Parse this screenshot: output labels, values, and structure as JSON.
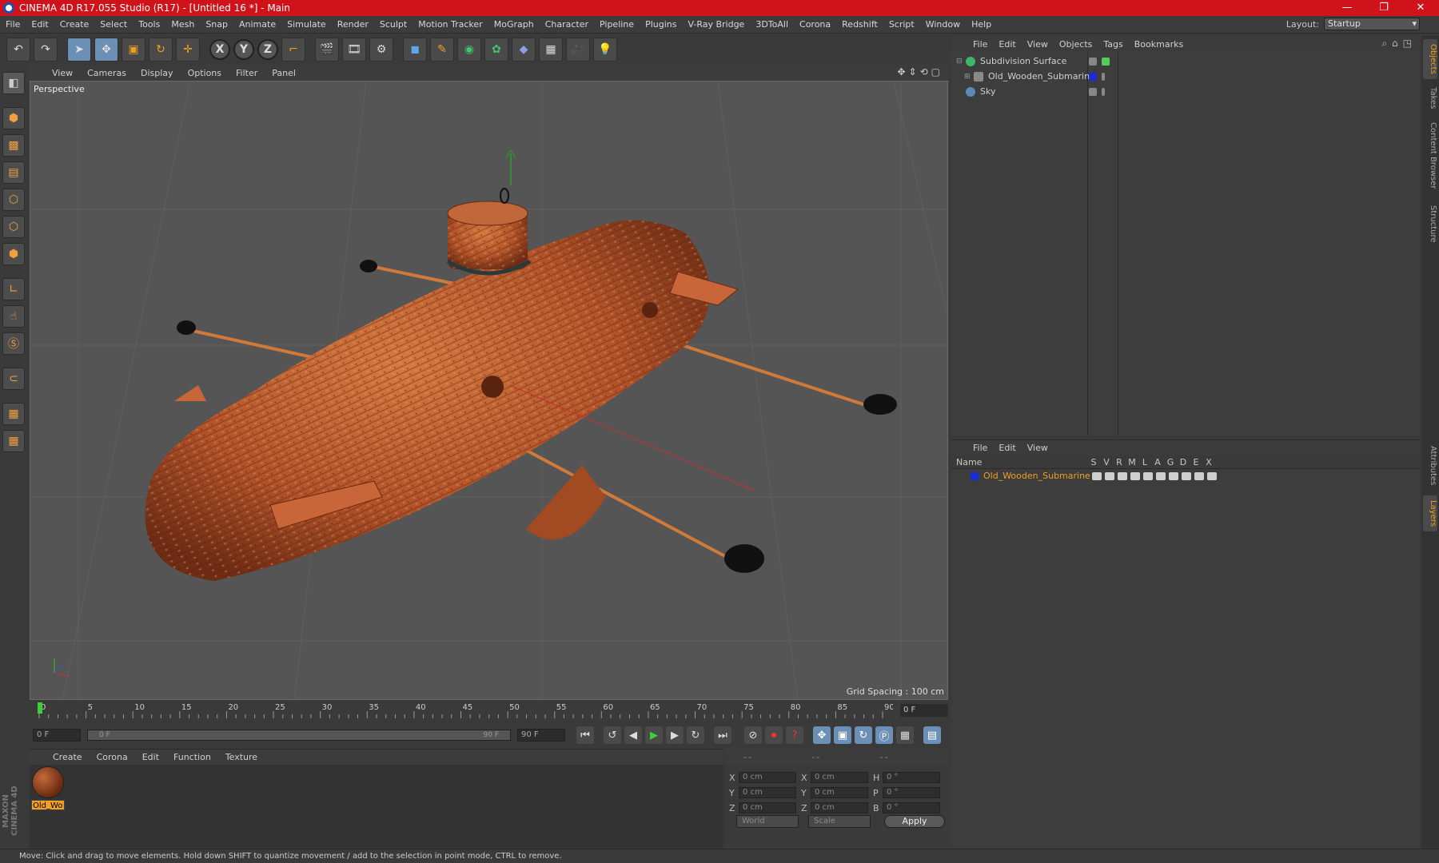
{
  "titlebar": {
    "title": "CINEMA 4D R17.055 Studio (R17) - [Untitled 16 *] - Main",
    "minimize": "—",
    "maximize": "❐",
    "close": "✕"
  },
  "menubar": {
    "items": [
      "File",
      "Edit",
      "Create",
      "Select",
      "Tools",
      "Mesh",
      "Snap",
      "Animate",
      "Simulate",
      "Render",
      "Sculpt",
      "Motion Tracker",
      "MoGraph",
      "Character",
      "Pipeline",
      "Plugins",
      "V-Ray Bridge",
      "3DToAll",
      "Corona",
      "Redshift",
      "Script",
      "Window",
      "Help"
    ],
    "layout_label": "Layout:",
    "layout_value": "Startup"
  },
  "toolbar": {
    "icons": [
      "undo-icon",
      "redo-icon",
      "select-cursor-icon",
      "move-icon",
      "scale-icon",
      "rotate-icon",
      "move-recent-icon",
      "x-axis-icon",
      "y-axis-icon",
      "z-axis-icon",
      "coordinate-system-icon",
      "render-view-icon",
      "render-picture-viewer-icon",
      "edit-render-settings-icon",
      "cube-icon",
      "pen-icon",
      "subdivision-icon",
      "cloner-icon",
      "deformer-icon",
      "floor-icon",
      "camera-icon",
      "light-icon"
    ],
    "x_label": "X",
    "y_label": "Y",
    "z_label": "Z"
  },
  "viewport": {
    "menu": [
      "View",
      "Cameras",
      "Display",
      "Options",
      "Filter",
      "Panel"
    ],
    "label": "Perspective",
    "grid_spacing": "Grid Spacing : 100 cm",
    "accent": "#d07a3a"
  },
  "timeline": {
    "ticks": [
      "0",
      "5",
      "10",
      "15",
      "20",
      "25",
      "30",
      "35",
      "40",
      "45",
      "50",
      "55",
      "60",
      "65",
      "70",
      "75",
      "80",
      "85",
      "90"
    ],
    "current_frame": "0 F"
  },
  "transport": {
    "start_field": "0 F",
    "range_start": "0 F",
    "range_end": "90 F",
    "end_field": "90 F"
  },
  "material_manager": {
    "menu": [
      "Create",
      "Corona",
      "Edit",
      "Function",
      "Texture"
    ],
    "material_name": "Old_Wo"
  },
  "coordinates": {
    "headers": [
      "--",
      "--",
      "--"
    ],
    "rows": [
      {
        "a": "X",
        "v1": "0 cm",
        "b": "X",
        "v2": "0 cm",
        "c": "H",
        "v3": "0 °"
      },
      {
        "a": "Y",
        "v1": "0 cm",
        "b": "Y",
        "v2": "0 cm",
        "c": "P",
        "v3": "0 °"
      },
      {
        "a": "Z",
        "v1": "0 cm",
        "b": "Z",
        "v2": "0 cm",
        "c": "B",
        "v3": "0 °"
      }
    ],
    "world_dropdown": "World",
    "scale_dropdown": "Scale",
    "apply": "Apply"
  },
  "status": "Move: Click and drag to move elements. Hold down SHIFT to quantize movement / add to the selection in point mode, CTRL to remove.",
  "object_manager": {
    "menu": [
      "File",
      "Edit",
      "View",
      "Objects",
      "Tags",
      "Bookmarks"
    ],
    "objects": [
      {
        "name": "Subdivision Surface",
        "color": "#3fb56a"
      },
      {
        "name": "Old_Wooden_Submarine",
        "color": "#8a8a8a"
      },
      {
        "name": "Sky",
        "color": "#5a8ab8"
      }
    ]
  },
  "layer_manager": {
    "menu": [
      "File",
      "Edit",
      "View"
    ],
    "name_header": "Name",
    "columns": [
      "S",
      "V",
      "R",
      "M",
      "L",
      "A",
      "G",
      "D",
      "E",
      "X"
    ],
    "layers": [
      {
        "name": "Old_Wooden_Submarine",
        "color": "#1b2cd6"
      }
    ]
  },
  "side_tabs": [
    "Objects",
    "Takes",
    "Content Browser",
    "Structure",
    "Attributes",
    "Layers"
  ],
  "maxon_logo": "MAXON CINEMA 4D"
}
